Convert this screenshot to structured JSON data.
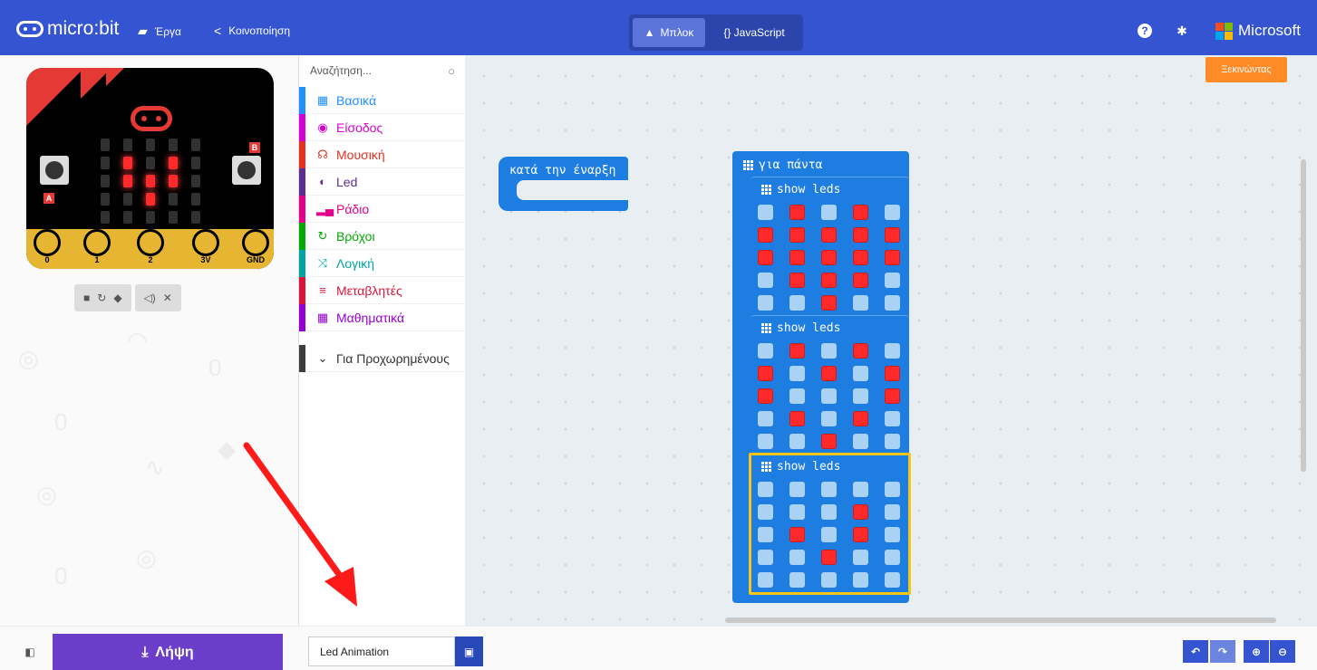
{
  "topbar": {
    "logo_text": "micro:bit",
    "projects_label": "Έργα",
    "share_label": "Κοινοποίηση",
    "blocks_label": "Μπλοκ",
    "javascript_label": "{} JavaScript",
    "microsoft_label": "Microsoft"
  },
  "simulator": {
    "pin_labels": [
      "0",
      "1",
      "2",
      "3V",
      "GND"
    ],
    "button_a": "A",
    "button_b": "B"
  },
  "toolbox": {
    "search_placeholder": "Αναζήτηση...",
    "categories": [
      {
        "label": "Βασικά",
        "color": "#1e90ff",
        "icon": "grid-icon"
      },
      {
        "label": "Είσοδος",
        "color": "#d400d4",
        "icon": "radio-target-icon"
      },
      {
        "label": "Μουσική",
        "color": "#e63022",
        "icon": "headphones-icon"
      },
      {
        "label": "Led",
        "color": "#5c2d91",
        "icon": "toggle-icon"
      },
      {
        "label": "Ράδιο",
        "color": "#e3008c",
        "icon": "signal-bars-icon"
      },
      {
        "label": "Βρόχοι",
        "color": "#00aa00",
        "icon": "refresh-icon"
      },
      {
        "label": "Λογική",
        "color": "#00a4a6",
        "icon": "shuffle-icon"
      },
      {
        "label": "Μεταβλητές",
        "color": "#dc143c",
        "icon": "list-icon"
      },
      {
        "label": "Μαθηματικά",
        "color": "#9400d3",
        "icon": "calculator-icon"
      },
      {
        "label": "Για Προχωρημένους",
        "color": "#3c3c3c",
        "icon": "chevron-down-icon"
      }
    ]
  },
  "workspace": {
    "start_button": "Ξεκινώντας",
    "on_start_label": "κατά την έναρξη",
    "forever_label": "για πάντα",
    "show_leds_label": "show leds",
    "led_patterns": [
      [
        [
          0,
          1,
          0,
          1,
          0
        ],
        [
          1,
          1,
          1,
          1,
          1
        ],
        [
          1,
          1,
          1,
          1,
          1
        ],
        [
          0,
          1,
          1,
          1,
          0
        ],
        [
          0,
          0,
          1,
          0,
          0
        ]
      ],
      [
        [
          0,
          1,
          0,
          1,
          0
        ],
        [
          1,
          0,
          1,
          0,
          1
        ],
        [
          1,
          0,
          0,
          0,
          1
        ],
        [
          0,
          1,
          0,
          1,
          0
        ],
        [
          0,
          0,
          1,
          0,
          0
        ]
      ],
      [
        [
          0,
          0,
          0,
          0,
          0
        ],
        [
          0,
          0,
          0,
          1,
          0
        ],
        [
          0,
          1,
          0,
          1,
          0
        ],
        [
          0,
          0,
          1,
          0,
          0
        ],
        [
          0,
          0,
          0,
          0,
          0
        ]
      ]
    ],
    "simulator_pattern": [
      [
        0,
        0,
        0,
        0,
        0
      ],
      [
        0,
        1,
        0,
        1,
        0
      ],
      [
        0,
        1,
        1,
        1,
        0
      ],
      [
        0,
        0,
        1,
        0,
        0
      ],
      [
        0,
        0,
        0,
        0,
        0
      ]
    ]
  },
  "bottombar": {
    "download_label": "Λήψη",
    "project_name": "Led Animation"
  },
  "colors": {
    "topbar": "#3454d1",
    "block_blue": "#1e7de1",
    "download_purple": "#6a3ec9",
    "start_orange": "#ff8b27",
    "led_on": "#ff2929",
    "led_off": "#a9d2f5"
  }
}
